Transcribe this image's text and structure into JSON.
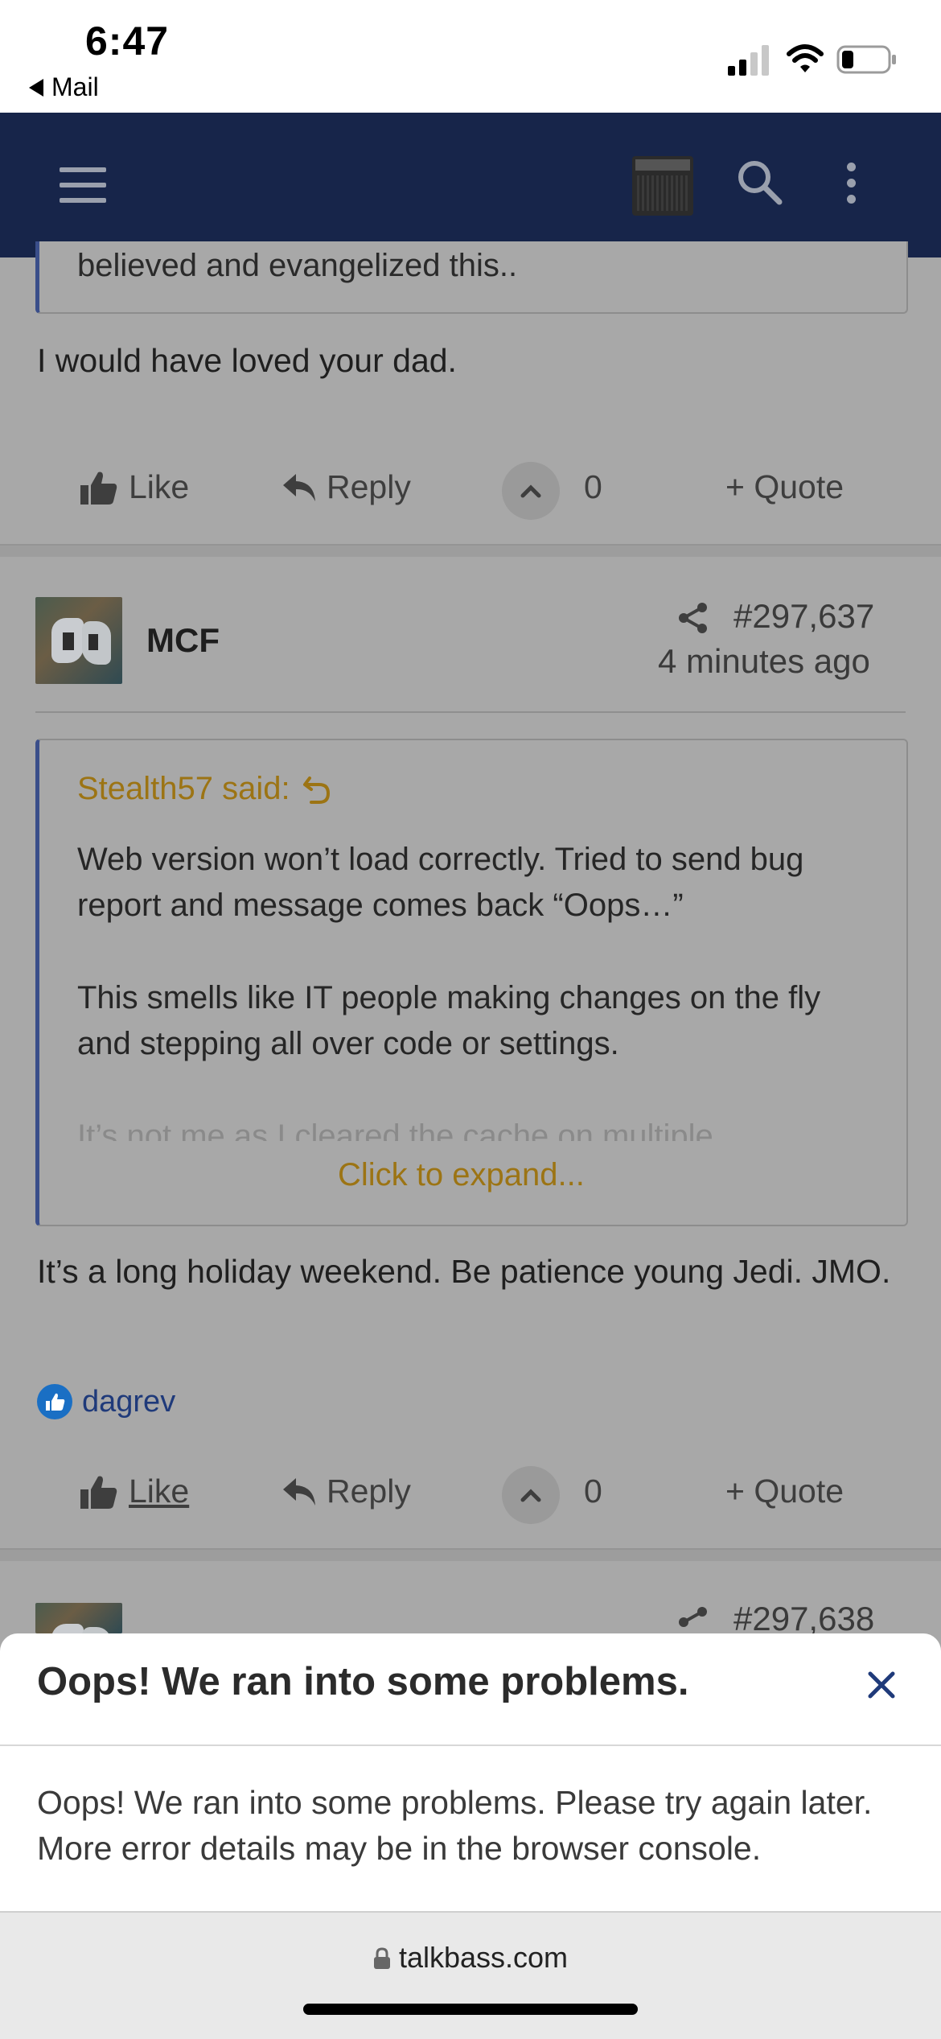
{
  "status_bar": {
    "time": "6:47",
    "back_label": "Mail"
  },
  "post_prev": {
    "quote_tail": "believed and evangelized this..",
    "body": "I would have loved your dad.",
    "actions": {
      "like": "Like",
      "reply": "Reply",
      "votes": "0",
      "quote": "+ Quote"
    }
  },
  "post_main": {
    "username": "MCF",
    "post_number": "#297,637",
    "timestamp": "4 minutes ago",
    "quote": {
      "attribution": "Stealth57 said:",
      "para1": "Web version won’t load correctly. Tried to send bug report and message comes back “Oops…”",
      "para2": "This smells like IT people making changes on the fly and stepping all over code or settings.",
      "para3": "It’s not me as I cleared the cache on multiple",
      "expand": "Click to expand..."
    },
    "body": "It’s a long holiday weekend. Be patience young Jedi. JMO.",
    "liked_by": "dagrev",
    "actions": {
      "like": "Like",
      "reply": "Reply",
      "votes": "0",
      "quote": "+ Quote"
    }
  },
  "post_next": {
    "post_number": "#297,638"
  },
  "modal": {
    "title": "Oops! We ran into some problems.",
    "body": "Oops! We ran into some problems. Please try again later. More error details may be in the browser console."
  },
  "browser": {
    "url": "talkbass.com"
  },
  "colors": {
    "nav_bg": "#17254a",
    "quote_accent": "#3a4e8a",
    "attribution_gold": "#9c7414",
    "link_blue": "#1f3a7a",
    "like_badge": "#1a6fc4"
  }
}
